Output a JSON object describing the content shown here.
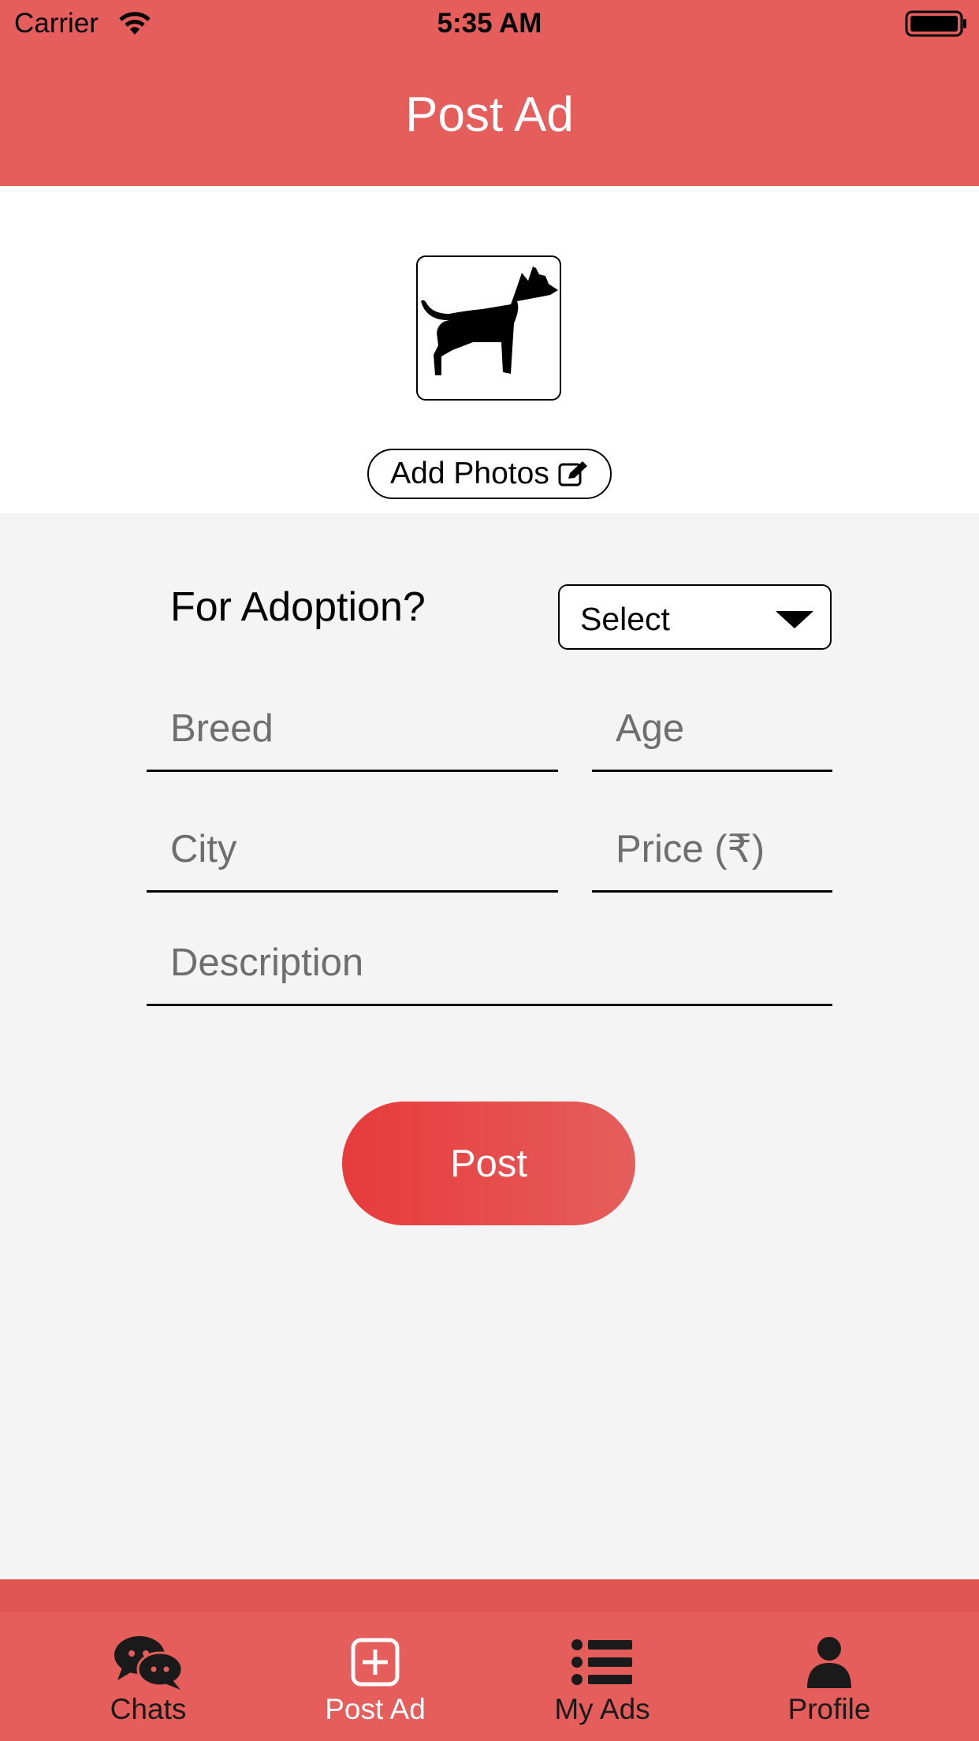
{
  "status_bar": {
    "carrier": "Carrier",
    "time": "5:35 AM"
  },
  "header": {
    "title": "Post Ad"
  },
  "photo": {
    "add_photos_label": "Add Photos",
    "image_icon": "dog-icon"
  },
  "form": {
    "adoption_label": "For Adoption?",
    "adoption_select_value": "Select",
    "breed_placeholder": "Breed",
    "age_placeholder": "Age",
    "city_placeholder": "City",
    "price_placeholder": "Price (₹)",
    "description_placeholder": "Description",
    "submit_label": "Post"
  },
  "tab_bar": {
    "items": [
      {
        "label": "Chats",
        "icon": "chat-bubbles-icon",
        "active": false
      },
      {
        "label": "Post Ad",
        "icon": "plus-square-icon",
        "active": true
      },
      {
        "label": "My Ads",
        "icon": "list-icon",
        "active": false
      },
      {
        "label": "Profile",
        "icon": "user-icon",
        "active": false
      }
    ]
  },
  "colors": {
    "brand": "#e55e5b",
    "button_gradient_start": "#e63b3b",
    "background": "#f4f4f4",
    "active_tab": "#ffffff",
    "inactive_tab": "#1a1a1a"
  }
}
